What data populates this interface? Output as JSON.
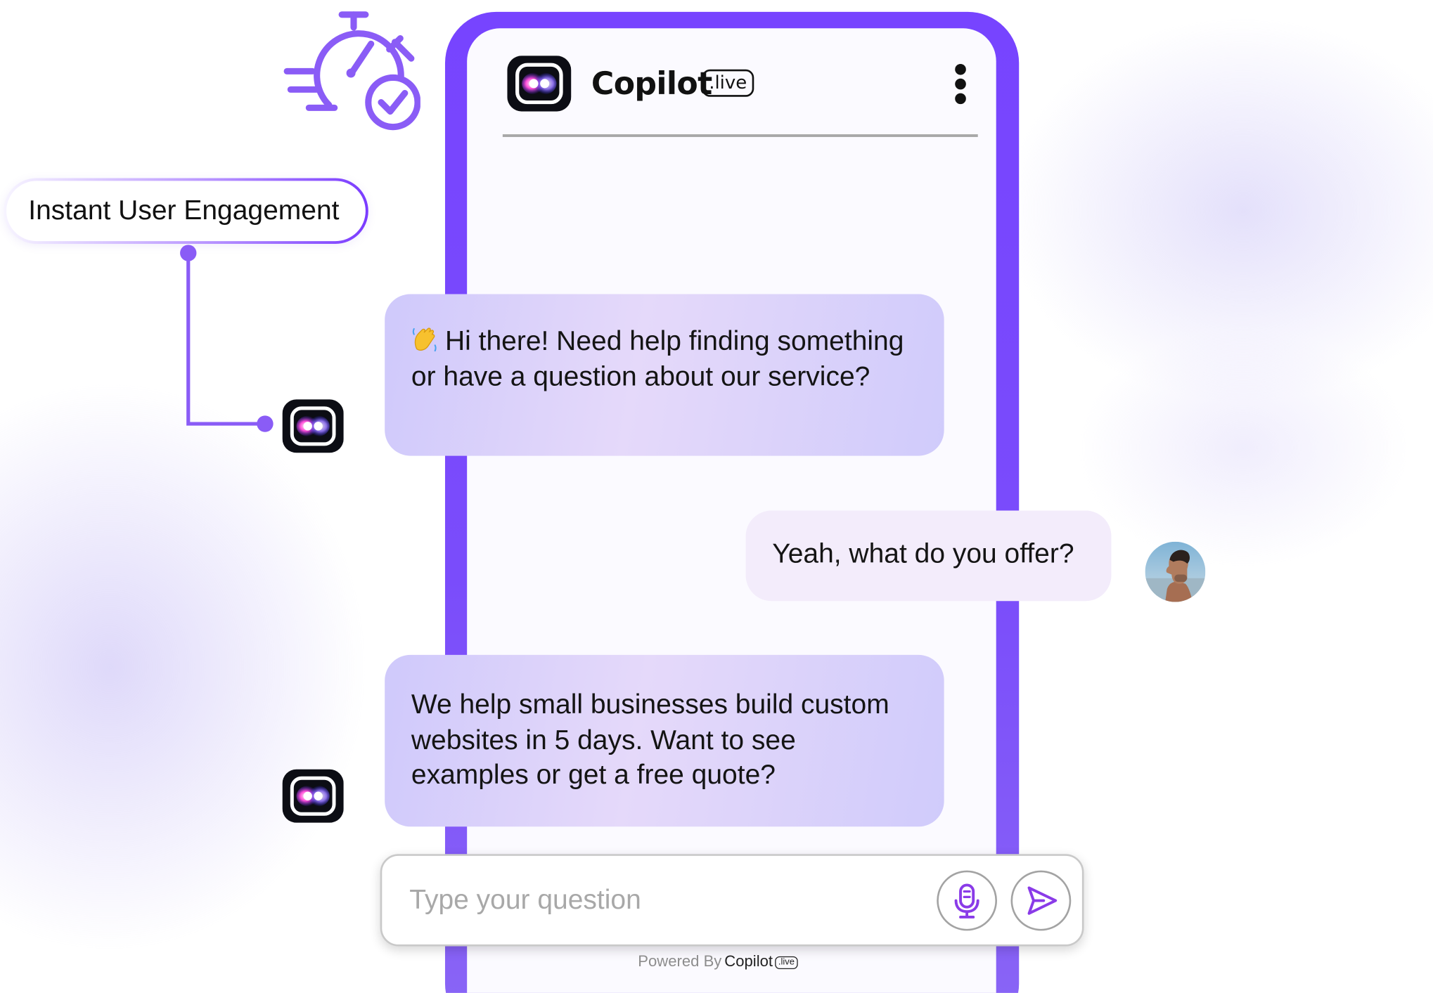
{
  "header": {
    "brand": "Copilot",
    "brand_badge": ".live",
    "menu_icon": "kebab-menu-icon",
    "logo_icon": "copilot-logo-icon"
  },
  "feature": {
    "label": "Instant User Engagement",
    "icon": "speed-check-icon"
  },
  "messages": [
    {
      "from": "bot",
      "emoji": "waving-hand-icon",
      "text": "Hi there! Need help finding something or have a question about our service?"
    },
    {
      "from": "user",
      "text": "Yeah, what do you offer?"
    },
    {
      "from": "bot",
      "text": "We help small businesses build custom websites in 5 days. Want to see examples or get a free quote?"
    }
  ],
  "input": {
    "placeholder": "Type your question",
    "value": "",
    "mic_icon": "microphone-icon",
    "send_icon": "send-icon"
  },
  "footer": {
    "powered_by": "Powered By",
    "brand": "Copilot",
    "badge": ".live"
  },
  "colors": {
    "accent": "#7744ff",
    "bot_bubble": "#d6cffb",
    "user_bubble": "#f3ecfb",
    "icon_purple": "#8a5cf6"
  }
}
